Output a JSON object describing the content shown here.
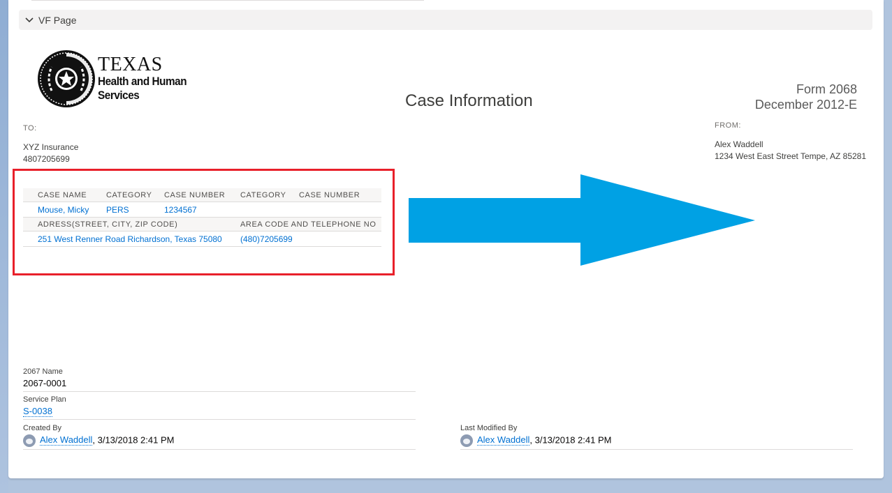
{
  "section": {
    "title": "VF Page"
  },
  "logo": {
    "line1": "TEXAS",
    "line2": "Health and Human",
    "line3": "Services"
  },
  "header": {
    "title": "Case Information",
    "form_number": "Form 2068",
    "form_date": "December 2012-E"
  },
  "to": {
    "label": "TO:",
    "name": "XYZ Insurance",
    "phone": "4807205699"
  },
  "from": {
    "label": "FROM:",
    "name": "Alex Waddell",
    "address": "1234 West East Street Tempe, AZ 85281"
  },
  "case_table": {
    "headers": [
      "CASE NAME",
      "CATEGORY",
      "CASE NUMBER",
      "CATEGORY",
      "CASE NUMBER"
    ],
    "row": [
      "Mouse, Micky",
      "PERS",
      "1234567",
      "",
      ""
    ],
    "address_header": "ADRESS(STREET, CITY, ZIP CODE)",
    "phone_header": "AREA CODE AND TELEPHONE NO",
    "address": "251 West Renner Road Richardson, Texas 75080",
    "phone": "(480)7205699"
  },
  "annotation": {
    "arrow_color": "#00a1e4",
    "box_color": "#e8202a"
  },
  "fields": {
    "name_label": "2067 Name",
    "name_value": "2067-0001",
    "plan_label": "Service Plan",
    "plan_value": "S-0038",
    "created_label": "Created By",
    "created_user": "Alex Waddell",
    "created_date": ", 3/13/2018 2:41 PM",
    "modified_label": "Last Modified By",
    "modified_user": "Alex Waddell",
    "modified_date": ", 3/13/2018 2:41 PM"
  }
}
